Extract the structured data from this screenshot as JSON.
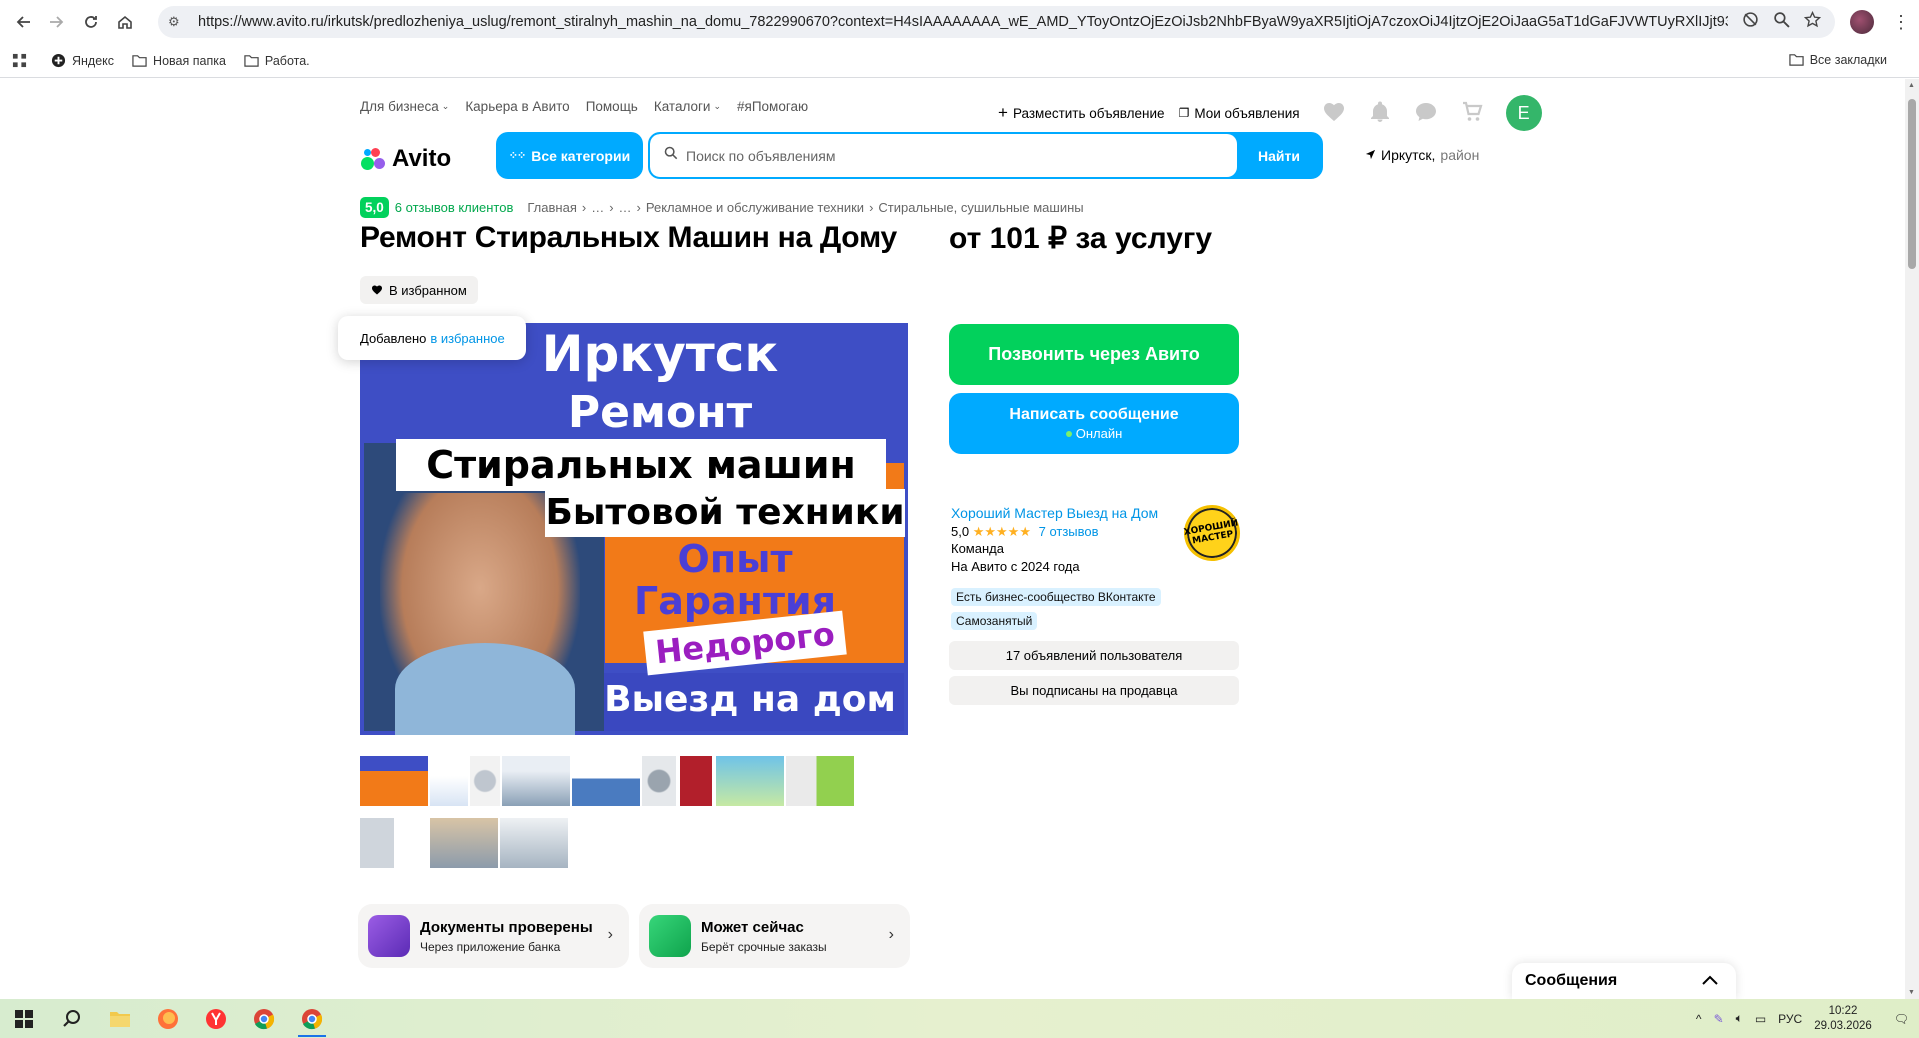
{
  "browser": {
    "url": "https://www.avito.ru/irkutsk/predlozheniya_uslug/remont_stiralnyh_mashin_na_domu_7822990670?context=H4sIAAAAAAAA_wE_AMD_YToyOntzOjEzOiJsb2NhbFByaW9yaXR5IjtiOjA7czoxOiJ4IjtzOjE2OiJaaG5aT1dGaFJVWTUyRXlIJjt933y6wT8AAAA#",
    "bookmarks": [
      "Яндекс",
      "Новая папка",
      "Работа."
    ],
    "all_bookmarks": "Все закладки"
  },
  "header": {
    "nav": [
      "Для бизнеса",
      "Карьера в Авито",
      "Помощь",
      "Каталоги",
      "#яПомогаю"
    ],
    "post_ad": "Разместить объявление",
    "my_ads": "Мои объявления",
    "avatar_letter": "E",
    "logo_text": "Avito",
    "all_categories": "Все категории",
    "search_placeholder": "Поиск по объявлениям",
    "search_button": "Найти",
    "location": "Иркутск,",
    "location_hint": "район"
  },
  "listing": {
    "rating": "5,0",
    "reviews_link": "6 отзывов клиентов",
    "breadcrumbs": [
      "Главная",
      "›",
      "…",
      "›",
      "…",
      "›",
      "Рекламное и обслуживание техники",
      "›",
      "Стиральные, сушильные машины"
    ],
    "title": "Ремонт Стиральных Машин на Дому",
    "price": "от 101 ₽ за услугу",
    "favorite_button": "В избранном",
    "tooltip_text": "Добавлено",
    "tooltip_link": "в избранное",
    "image_text": {
      "line1": "Иркутск",
      "line2": "Ремонт",
      "line3": "Стиральных машин",
      "line4": "Бытовой техники",
      "line5": "Опыт",
      "line6": "Гарантия",
      "line7": "Недорого",
      "line8": "Выезд на дом"
    },
    "badges": [
      {
        "title": "Документы проверены",
        "subtitle": "Через приложение банка"
      },
      {
        "title": "Может сейчас",
        "subtitle": "Берёт срочные заказы"
      }
    ]
  },
  "contact": {
    "call_button": "Позвонить через Авито",
    "message_button": "Написать сообщение",
    "online": "Онлайн",
    "seller_name": "Хороший Мастер Выезд на Дом",
    "seller_rating": "5,0",
    "seller_stars": "★★★★★",
    "seller_reviews": "7 отзывов",
    "seller_type": "Команда",
    "seller_since": "На Авито с 2024 года",
    "seller_logo_text": "ХОРОШИЙ МАСТЕР",
    "chip1": "Есть бизнес-сообщество ВКонтакте",
    "chip2": "Самозанятый",
    "user_ads": "17 объявлений пользователя",
    "subscribed": "Вы подписаны на продавца"
  },
  "messages_widget": "Сообщения",
  "taskbar": {
    "lang": "РУС",
    "time": "10:22",
    "date": "29.03.2026"
  },
  "colors": {
    "avito_blue": "#00aaff",
    "avito_green": "#02d15c",
    "link_blue": "#0095e6"
  }
}
